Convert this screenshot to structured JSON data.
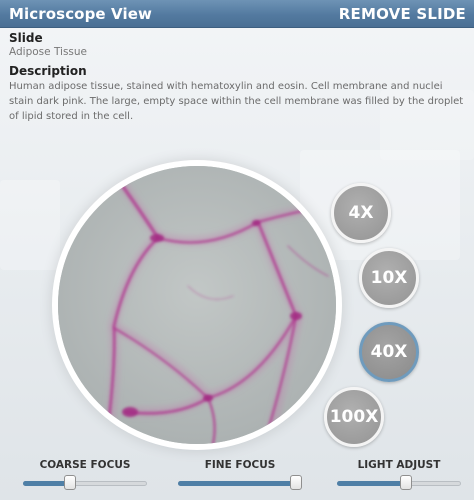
{
  "window": {
    "title": "Microscope View",
    "remove_label": "REMOVE SLIDE"
  },
  "slide": {
    "heading": "Slide",
    "name": "Adipose Tissue"
  },
  "description": {
    "heading": "Description",
    "text": "Human adipose tissue, stained with hematoxylin and eosin. Cell membrane and nuclei stain dark pink. The large, empty space within the cell membrane was filled by the droplet of lipid stored in the cell."
  },
  "magnification": {
    "options": [
      "4X",
      "10X",
      "40X",
      "100X"
    ],
    "selected": "40X"
  },
  "controls": {
    "coarse_focus": {
      "label": "COARSE FOCUS",
      "value": 0.38
    },
    "fine_focus": {
      "label": "FINE FOCUS",
      "value": 0.95
    },
    "light_adjust": {
      "label": "LIGHT ADJUST",
      "value": 0.56
    }
  },
  "colors": {
    "title_bar": "#537aa0",
    "slider_fill": "#4f7fa6",
    "stain": "#b0368f",
    "active_ring": "#6f9bbd"
  }
}
